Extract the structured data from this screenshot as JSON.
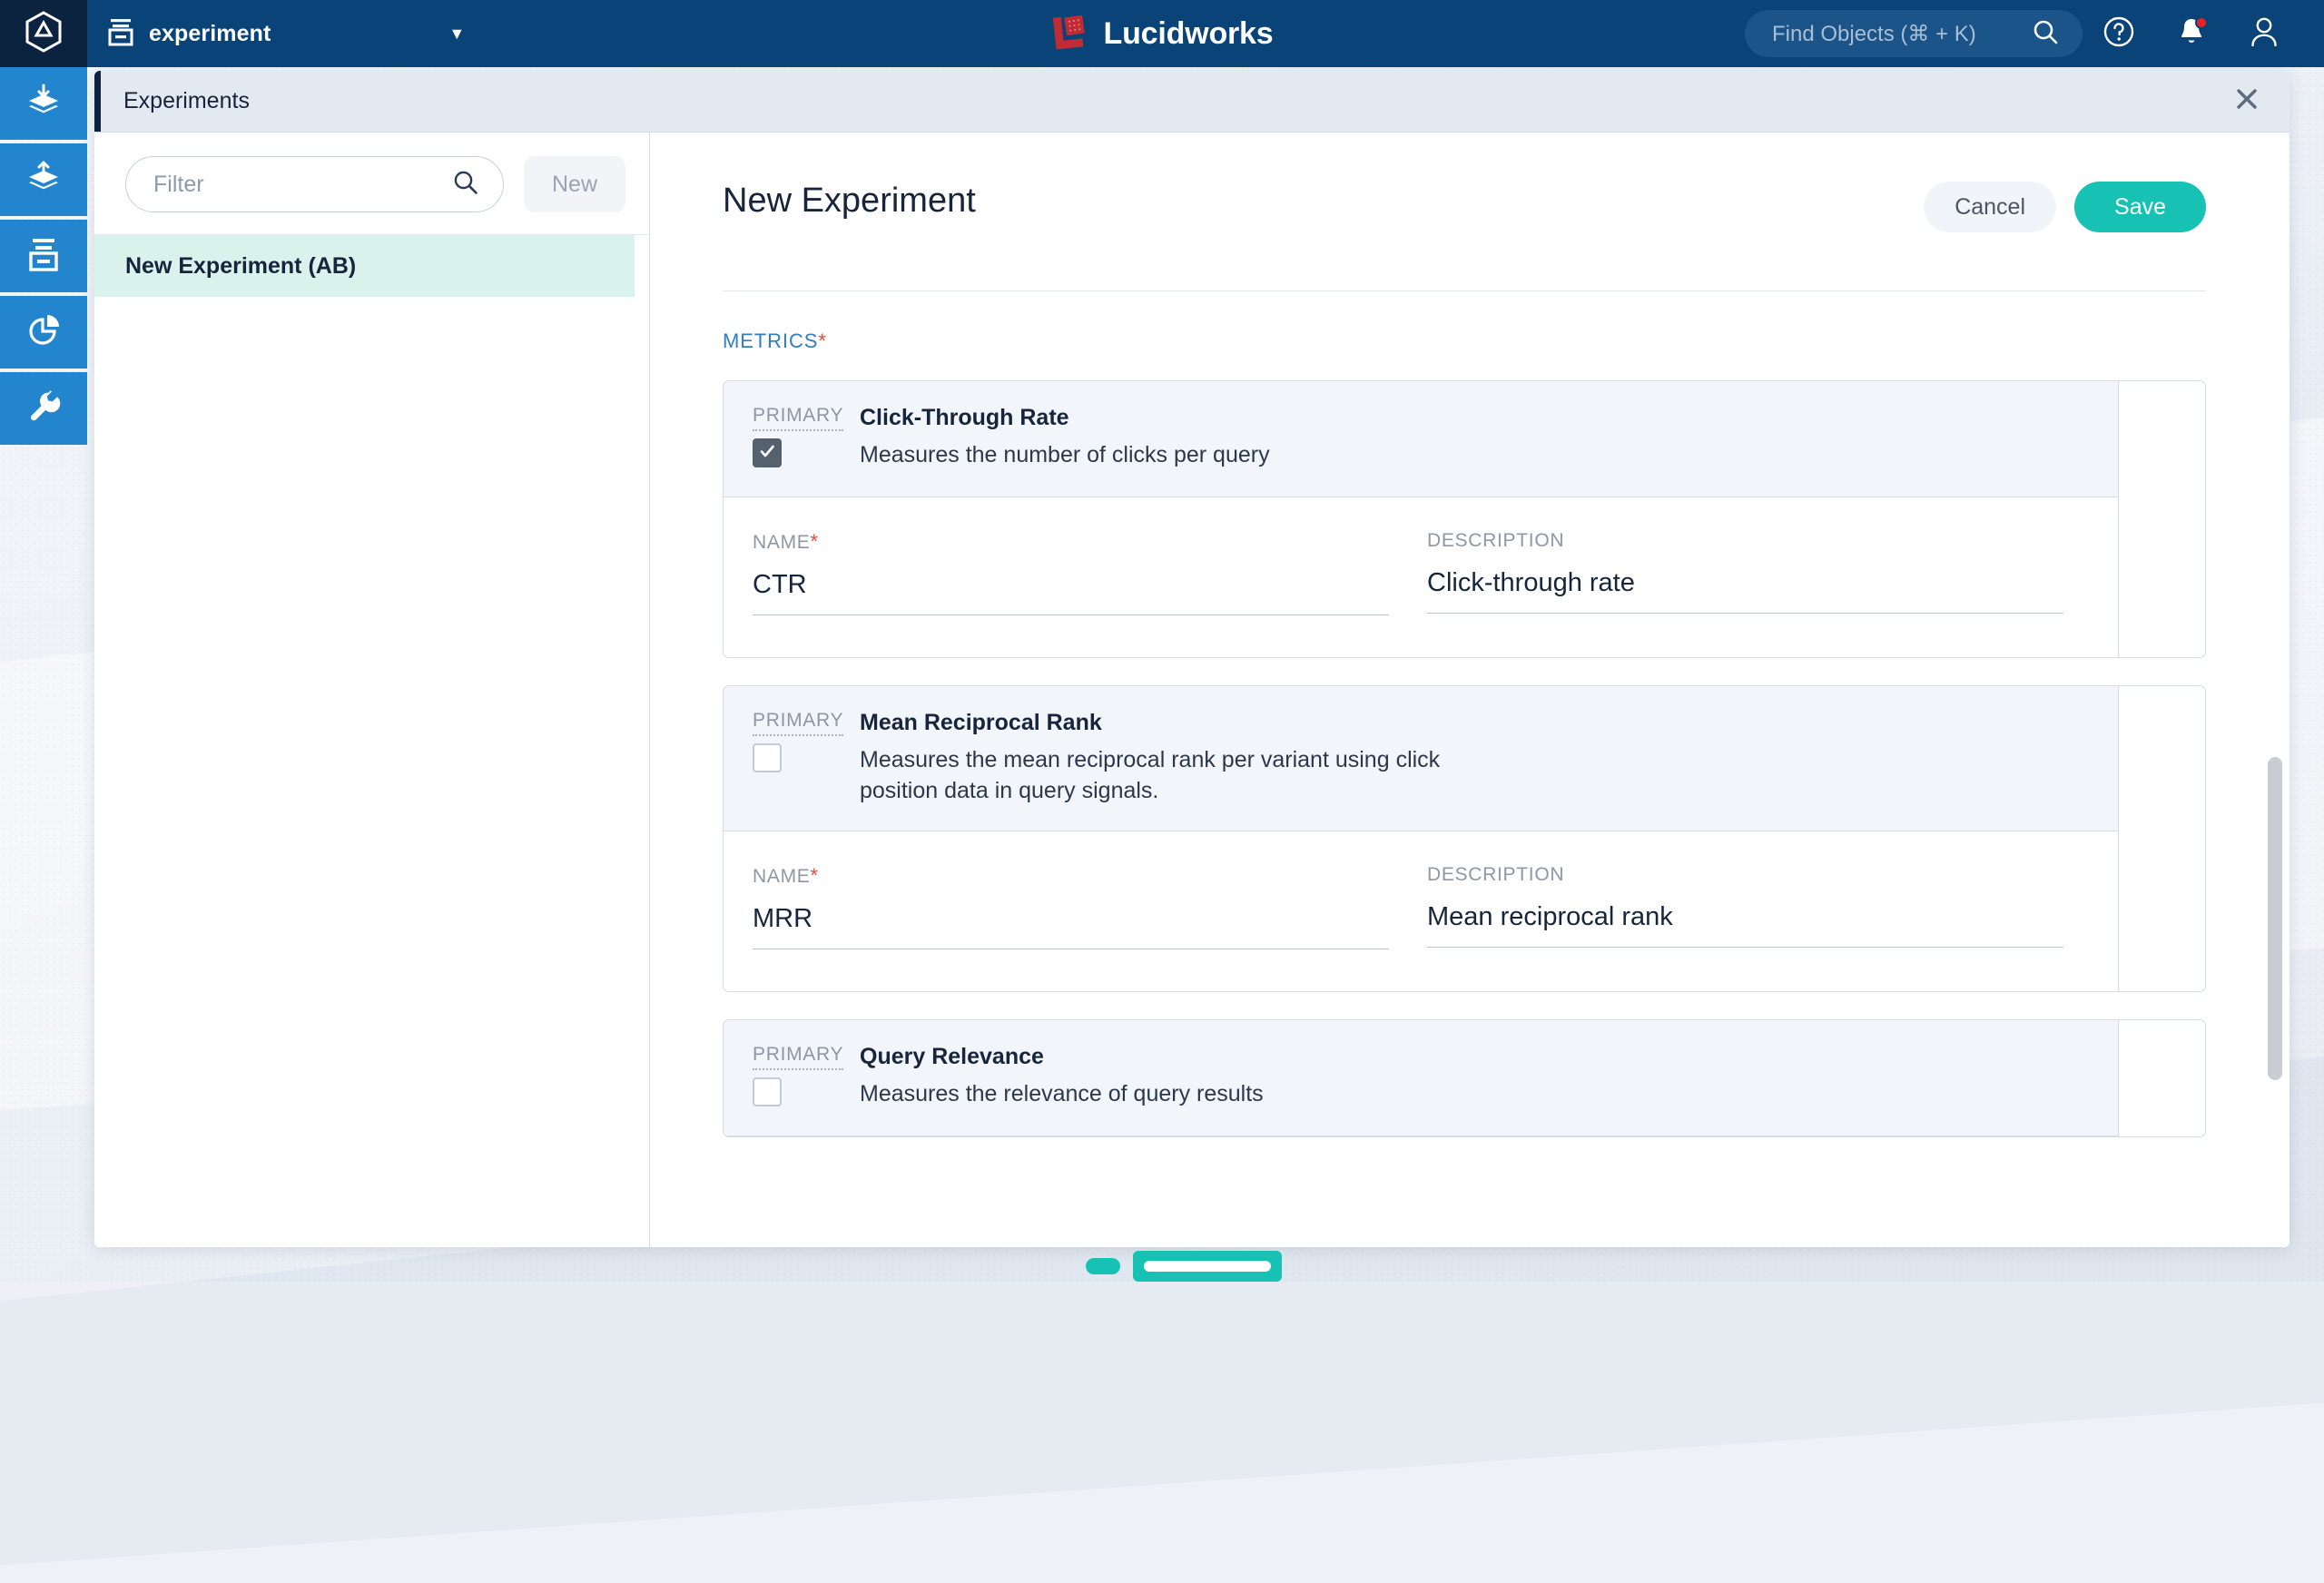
{
  "topbar": {
    "logo_icon": "fusion-hexagon-logo-icon",
    "app_name": "experiment",
    "app_icon": "archive-box-icon",
    "caret_icon": "chevron-down-icon",
    "brand_name": "Lucidworks",
    "brand_logo_icon": "lucidworks-mark-icon",
    "search_placeholder": "Find Objects (⌘ + K)",
    "search_icon": "search-icon",
    "help_icon": "help-circle-icon",
    "notifications_icon": "bell-icon",
    "account_icon": "user-avatar-icon",
    "bg_color": "#0a4377",
    "logo_tile_color": "#0c2340"
  },
  "rail": {
    "accent": "#2285ce",
    "items": [
      {
        "name": "indexing",
        "icon": "layers-download-icon"
      },
      {
        "name": "querying",
        "icon": "layers-upload-icon"
      },
      {
        "name": "experiments",
        "icon": "archive-box-icon"
      },
      {
        "name": "analytics",
        "icon": "pie-chart-icon"
      },
      {
        "name": "tools",
        "icon": "wrench-icon"
      }
    ]
  },
  "modal": {
    "title": "Experiments",
    "close_icon": "close-icon"
  },
  "listpane": {
    "filter_placeholder": "Filter",
    "filter_value": "",
    "search_icon": "search-icon",
    "new_label": "New",
    "items": [
      {
        "label": "New Experiment (AB)",
        "selected": true
      }
    ],
    "selected_bg": "#d9f2ec"
  },
  "content": {
    "page_title": "New Experiment",
    "cancel_label": "Cancel",
    "save_label": "Save",
    "save_color": "#17c2b5",
    "section_label": "METRICS",
    "section_required": "*",
    "primary_label": "PRIMARY",
    "name_label": "NAME",
    "name_required": "*",
    "description_label": "DESCRIPTION",
    "metrics": [
      {
        "title": "Click-Through Rate",
        "description": "Measures the number of clicks per query",
        "primary_checked": true,
        "name_value": "CTR",
        "description_value": "Click-through rate",
        "has_fields": true
      },
      {
        "title": "Mean Reciprocal Rank",
        "description": "Measures the mean reciprocal rank per variant using click position data in query signals.",
        "primary_checked": false,
        "name_value": "MRR",
        "description_value": "Mean reciprocal rank",
        "has_fields": true
      },
      {
        "title": "Query Relevance",
        "description": "Measures the relevance of query results",
        "primary_checked": false,
        "name_value": "",
        "description_value": "",
        "has_fields": false
      }
    ]
  },
  "scrollbar": {
    "name": "content-vertical-scrollbar"
  }
}
